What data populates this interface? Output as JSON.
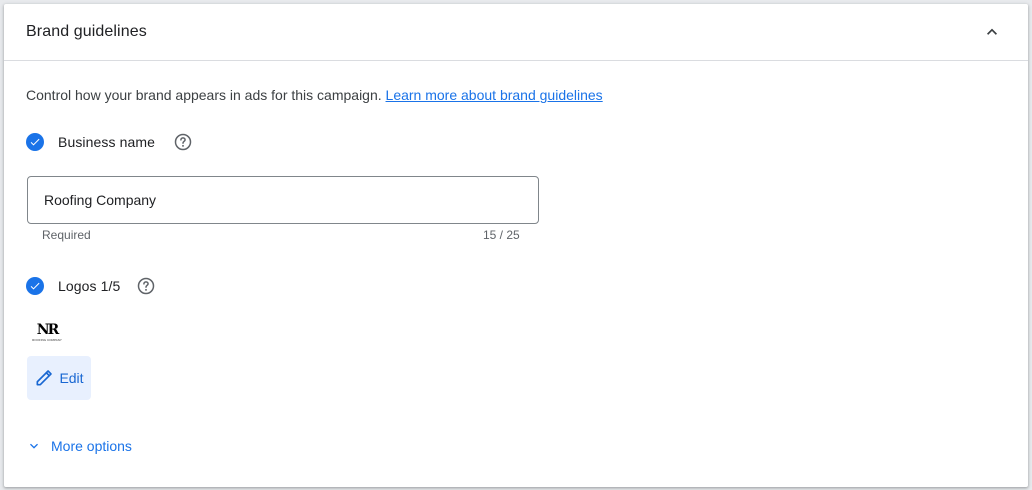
{
  "header": {
    "title": "Brand guidelines"
  },
  "description": {
    "text": "Control how your brand appears in ads for this campaign. ",
    "link": "Learn more about brand guidelines"
  },
  "business_name": {
    "label": "Business name",
    "checked": true,
    "value": "Roofing Company",
    "hint": "Required",
    "counter": "15 / 25"
  },
  "logos": {
    "label": "Logos 1/5",
    "checked": true,
    "logo_mark": "NR",
    "logo_sub": "ROOFING COMPANY"
  },
  "edit_button": {
    "label": "Edit"
  },
  "more_options": {
    "label": "More options"
  },
  "colors": {
    "accent": "#1a73e8",
    "edit_bg": "#e8f0fe"
  }
}
